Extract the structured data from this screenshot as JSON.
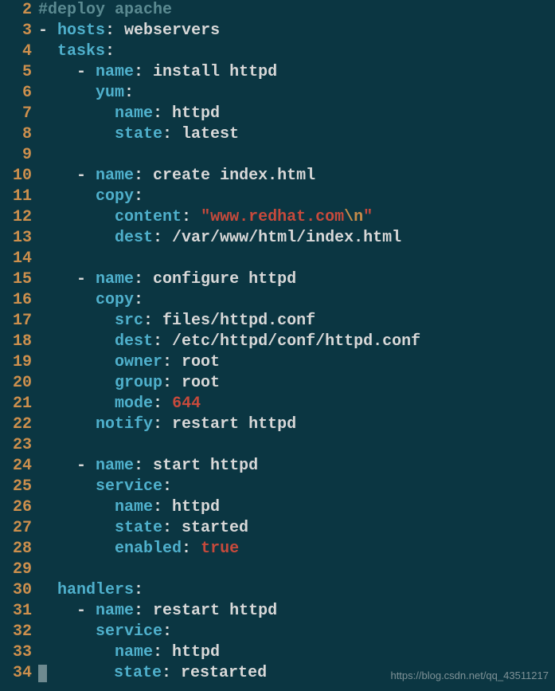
{
  "watermark": "https://blog.csdn.net/qq_43511217",
  "lines": [
    {
      "num": "2",
      "tokens": [
        {
          "t": "#deploy apache",
          "c": "c-comment"
        }
      ]
    },
    {
      "num": "3",
      "tokens": [
        {
          "t": "- ",
          "c": "c-dash"
        },
        {
          "t": "hosts",
          "c": "c-key"
        },
        {
          "t": ":",
          "c": "c-colon"
        },
        {
          "t": " webservers",
          "c": "c-text"
        }
      ]
    },
    {
      "num": "4",
      "tokens": [
        {
          "t": "  ",
          "c": "c-text"
        },
        {
          "t": "tasks",
          "c": "c-key"
        },
        {
          "t": ":",
          "c": "c-colon"
        }
      ]
    },
    {
      "num": "5",
      "tokens": [
        {
          "t": "    - ",
          "c": "c-dash"
        },
        {
          "t": "name",
          "c": "c-key"
        },
        {
          "t": ":",
          "c": "c-colon"
        },
        {
          "t": " install httpd",
          "c": "c-text"
        }
      ]
    },
    {
      "num": "6",
      "tokens": [
        {
          "t": "      ",
          "c": "c-text"
        },
        {
          "t": "yum",
          "c": "c-key"
        },
        {
          "t": ":",
          "c": "c-colon"
        }
      ]
    },
    {
      "num": "7",
      "tokens": [
        {
          "t": "        ",
          "c": "c-text"
        },
        {
          "t": "name",
          "c": "c-key"
        },
        {
          "t": ":",
          "c": "c-colon"
        },
        {
          "t": " httpd",
          "c": "c-text"
        }
      ]
    },
    {
      "num": "8",
      "tokens": [
        {
          "t": "        ",
          "c": "c-text"
        },
        {
          "t": "state",
          "c": "c-key"
        },
        {
          "t": ":",
          "c": "c-colon"
        },
        {
          "t": " latest",
          "c": "c-text"
        }
      ]
    },
    {
      "num": "9",
      "tokens": [
        {
          "t": "",
          "c": "c-text"
        }
      ]
    },
    {
      "num": "10",
      "tokens": [
        {
          "t": "    - ",
          "c": "c-dash"
        },
        {
          "t": "name",
          "c": "c-key"
        },
        {
          "t": ":",
          "c": "c-colon"
        },
        {
          "t": " create index.html",
          "c": "c-text"
        }
      ]
    },
    {
      "num": "11",
      "tokens": [
        {
          "t": "      ",
          "c": "c-text"
        },
        {
          "t": "copy",
          "c": "c-key"
        },
        {
          "t": ":",
          "c": "c-colon"
        }
      ]
    },
    {
      "num": "12",
      "tokens": [
        {
          "t": "        ",
          "c": "c-text"
        },
        {
          "t": "content",
          "c": "c-key"
        },
        {
          "t": ":",
          "c": "c-colon"
        },
        {
          "t": " ",
          "c": "c-text"
        },
        {
          "t": "\"www.redhat.com",
          "c": "c-str"
        },
        {
          "t": "\\n",
          "c": "c-esc"
        },
        {
          "t": "\"",
          "c": "c-str"
        }
      ]
    },
    {
      "num": "13",
      "tokens": [
        {
          "t": "        ",
          "c": "c-text"
        },
        {
          "t": "dest",
          "c": "c-key"
        },
        {
          "t": ":",
          "c": "c-colon"
        },
        {
          "t": " /var/www/html/index.html",
          "c": "c-text"
        }
      ]
    },
    {
      "num": "14",
      "tokens": [
        {
          "t": "",
          "c": "c-text"
        }
      ]
    },
    {
      "num": "15",
      "tokens": [
        {
          "t": "    - ",
          "c": "c-dash"
        },
        {
          "t": "name",
          "c": "c-key"
        },
        {
          "t": ":",
          "c": "c-colon"
        },
        {
          "t": " configure httpd",
          "c": "c-text"
        }
      ]
    },
    {
      "num": "16",
      "tokens": [
        {
          "t": "      ",
          "c": "c-text"
        },
        {
          "t": "copy",
          "c": "c-key"
        },
        {
          "t": ":",
          "c": "c-colon"
        }
      ]
    },
    {
      "num": "17",
      "tokens": [
        {
          "t": "        ",
          "c": "c-text"
        },
        {
          "t": "src",
          "c": "c-key"
        },
        {
          "t": ":",
          "c": "c-colon"
        },
        {
          "t": " files/httpd.conf",
          "c": "c-text"
        }
      ]
    },
    {
      "num": "18",
      "tokens": [
        {
          "t": "        ",
          "c": "c-text"
        },
        {
          "t": "dest",
          "c": "c-key"
        },
        {
          "t": ":",
          "c": "c-colon"
        },
        {
          "t": " /etc/httpd/conf/httpd.conf",
          "c": "c-text"
        }
      ]
    },
    {
      "num": "19",
      "tokens": [
        {
          "t": "        ",
          "c": "c-text"
        },
        {
          "t": "owner",
          "c": "c-key"
        },
        {
          "t": ":",
          "c": "c-colon"
        },
        {
          "t": " root",
          "c": "c-text"
        }
      ]
    },
    {
      "num": "20",
      "tokens": [
        {
          "t": "        ",
          "c": "c-text"
        },
        {
          "t": "group",
          "c": "c-key"
        },
        {
          "t": ":",
          "c": "c-colon"
        },
        {
          "t": " root",
          "c": "c-text"
        }
      ]
    },
    {
      "num": "21",
      "tokens": [
        {
          "t": "        ",
          "c": "c-text"
        },
        {
          "t": "mode",
          "c": "c-key"
        },
        {
          "t": ":",
          "c": "c-colon"
        },
        {
          "t": " ",
          "c": "c-text"
        },
        {
          "t": "644",
          "c": "c-num"
        }
      ]
    },
    {
      "num": "22",
      "tokens": [
        {
          "t": "      ",
          "c": "c-text"
        },
        {
          "t": "notify",
          "c": "c-key"
        },
        {
          "t": ":",
          "c": "c-colon"
        },
        {
          "t": " restart httpd",
          "c": "c-text"
        }
      ]
    },
    {
      "num": "23",
      "tokens": [
        {
          "t": "",
          "c": "c-text"
        }
      ]
    },
    {
      "num": "24",
      "tokens": [
        {
          "t": "    - ",
          "c": "c-dash"
        },
        {
          "t": "name",
          "c": "c-key"
        },
        {
          "t": ":",
          "c": "c-colon"
        },
        {
          "t": " start httpd",
          "c": "c-text"
        }
      ]
    },
    {
      "num": "25",
      "tokens": [
        {
          "t": "      ",
          "c": "c-text"
        },
        {
          "t": "service",
          "c": "c-key"
        },
        {
          "t": ":",
          "c": "c-colon"
        }
      ]
    },
    {
      "num": "26",
      "tokens": [
        {
          "t": "        ",
          "c": "c-text"
        },
        {
          "t": "name",
          "c": "c-key"
        },
        {
          "t": ":",
          "c": "c-colon"
        },
        {
          "t": " httpd",
          "c": "c-text"
        }
      ]
    },
    {
      "num": "27",
      "tokens": [
        {
          "t": "        ",
          "c": "c-text"
        },
        {
          "t": "state",
          "c": "c-key"
        },
        {
          "t": ":",
          "c": "c-colon"
        },
        {
          "t": " started",
          "c": "c-text"
        }
      ]
    },
    {
      "num": "28",
      "tokens": [
        {
          "t": "        ",
          "c": "c-text"
        },
        {
          "t": "enabled",
          "c": "c-key"
        },
        {
          "t": ":",
          "c": "c-colon"
        },
        {
          "t": " ",
          "c": "c-text"
        },
        {
          "t": "true",
          "c": "c-bool"
        }
      ]
    },
    {
      "num": "29",
      "tokens": [
        {
          "t": "",
          "c": "c-text"
        }
      ]
    },
    {
      "num": "30",
      "tokens": [
        {
          "t": "  ",
          "c": "c-text"
        },
        {
          "t": "handlers",
          "c": "c-key"
        },
        {
          "t": ":",
          "c": "c-colon"
        }
      ]
    },
    {
      "num": "31",
      "tokens": [
        {
          "t": "    - ",
          "c": "c-dash"
        },
        {
          "t": "name",
          "c": "c-key"
        },
        {
          "t": ":",
          "c": "c-colon"
        },
        {
          "t": " restart httpd",
          "c": "c-text"
        }
      ]
    },
    {
      "num": "32",
      "tokens": [
        {
          "t": "      ",
          "c": "c-text"
        },
        {
          "t": "service",
          "c": "c-key"
        },
        {
          "t": ":",
          "c": "c-colon"
        }
      ]
    },
    {
      "num": "33",
      "tokens": [
        {
          "t": "        ",
          "c": "c-text"
        },
        {
          "t": "name",
          "c": "c-key"
        },
        {
          "t": ":",
          "c": "c-colon"
        },
        {
          "t": " httpd",
          "c": "c-text"
        }
      ]
    },
    {
      "num": "34",
      "cursor": true,
      "tokens": [
        {
          "t": "       ",
          "c": "c-text"
        },
        {
          "t": "state",
          "c": "c-key"
        },
        {
          "t": ":",
          "c": "c-colon"
        },
        {
          "t": " restarted",
          "c": "c-text"
        }
      ]
    }
  ]
}
